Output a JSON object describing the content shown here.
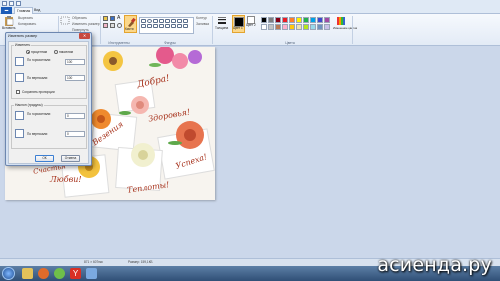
{
  "tabs": {
    "file": "▬",
    "home": "Главная",
    "view": "Вид"
  },
  "ribbon": {
    "clipboard": {
      "paste": "Вставить",
      "cut": "Вырезать",
      "copy": "Копировать"
    },
    "image": {
      "select": "Выделить",
      "crop": "Обрезать",
      "resize": "Изменить размер",
      "rotate": "Повернуть"
    },
    "tools_label": "Инструменты",
    "brushes": "Кисти",
    "shapes": {
      "outline": "Контур",
      "fill": "Заливка",
      "label": "Фигуры"
    },
    "thickness": "Толщина",
    "color1": "Цвет 1",
    "color2": "Цвет 2",
    "edit_colors": "Изменение цветов",
    "colors_label": "Цвета",
    "palette": [
      "#000000",
      "#7f7f7f",
      "#880015",
      "#ed1c24",
      "#ff7f27",
      "#fff200",
      "#22b14c",
      "#00a2e8",
      "#3f48cc",
      "#a349a4",
      "#ffffff",
      "#c3c3c3",
      "#b97a57",
      "#ffaec9",
      "#ffc90e",
      "#efe4b0",
      "#b5e61d",
      "#99d9ea",
      "#7092be",
      "#c8bfe7"
    ]
  },
  "image_text": {
    "dobra": "Добра!",
    "zdorovya": "Здоровья!",
    "vezeniya": "Везения",
    "uspeha": "Успеха!",
    "lyubvi": "Любви!",
    "tepla": "Теплоты!",
    "partial": "Счастья"
  },
  "dialog": {
    "title": "Изменить размер",
    "close": "✕",
    "resize_group": "Изменить",
    "percent": "процентам",
    "pixels": "пикселям",
    "horizontal_label": "По горизонтали:",
    "horizontal_value": "100",
    "vertical_label": "По вертикали:",
    "vertical_value": "100",
    "keep_ratio": "Сохранять пропорции",
    "skew_group": "Наклон (градусы)",
    "skew_h_label": "По горизонтали:",
    "skew_h_value": "0",
    "skew_v_label": "По вертикали:",
    "skew_v_value": "0",
    "ok": "ОК",
    "cancel": "Отмена"
  },
  "status": {
    "size": "871 × 607пкс",
    "file_size": "Размер: 159,1КБ"
  },
  "watermark": "асиенда.ру"
}
